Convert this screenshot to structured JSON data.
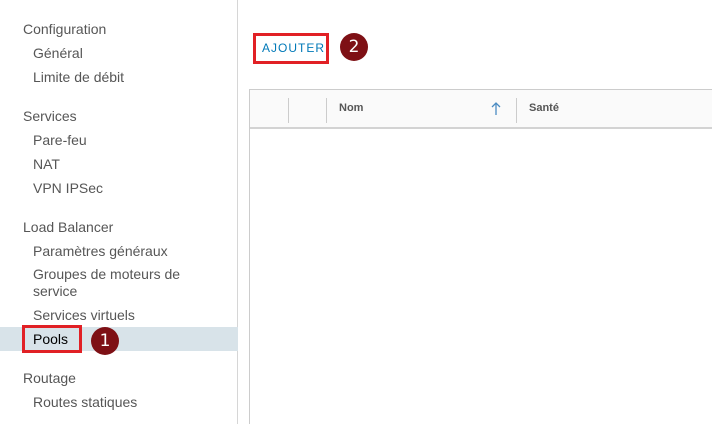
{
  "sidebar": {
    "sections": [
      {
        "title": "Configuration",
        "items": [
          "Général",
          "Limite de débit"
        ]
      },
      {
        "title": "Services",
        "items": [
          "Pare-feu",
          "NAT",
          "VPN IPSec"
        ]
      },
      {
        "title": "Load Balancer",
        "items": [
          "Paramètres généraux",
          "Groupes de moteurs de service",
          "Services virtuels",
          "Pools"
        ]
      },
      {
        "title": "Routage",
        "items": [
          "Routes statiques"
        ]
      }
    ],
    "active_item": "Pools"
  },
  "main": {
    "add_button_label": "AJOUTER",
    "grid": {
      "columns": [
        "Nom",
        "Santé"
      ],
      "sort_column": "Nom",
      "sort_direction": "ascending",
      "rows": []
    }
  },
  "callouts": [
    "1",
    "2"
  ],
  "colors": {
    "link": "#0079b8",
    "active_bg": "#d8e3e9",
    "highlight": "#e12025",
    "callout_bg": "#7e1015"
  }
}
